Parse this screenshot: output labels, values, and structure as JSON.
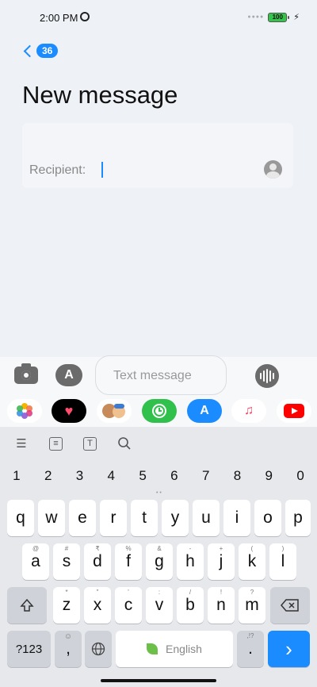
{
  "status_bar": {
    "time": "2:00 PM",
    "battery": "100"
  },
  "header": {
    "back_count": "36",
    "title": "New message"
  },
  "recipient": {
    "label": "Recipient:"
  },
  "compose": {
    "placeholder": "Text message"
  },
  "apps_row": {
    "items": [
      {
        "name": "photos-app",
        "color": "#ffffff"
      },
      {
        "name": "digital-touch-app",
        "color": "#000000"
      },
      {
        "name": "memoji-app",
        "color": "#ffffff"
      },
      {
        "name": "activity-app",
        "color": "#2fc14b"
      },
      {
        "name": "app-store-app",
        "color": "#1a8cff"
      },
      {
        "name": "music-app",
        "color": "#ffffff"
      },
      {
        "name": "youtube-app",
        "color": "#ffffff"
      }
    ]
  },
  "keyboard": {
    "numbers": [
      "1",
      "2",
      "3",
      "4",
      "5",
      "6",
      "7",
      "8",
      "9",
      "0"
    ],
    "row1": [
      "q",
      "w",
      "e",
      "r",
      "t",
      "y",
      "u",
      "i",
      "o",
      "p"
    ],
    "row2": [
      "a",
      "s",
      "d",
      "f",
      "g",
      "h",
      "j",
      "k",
      "l"
    ],
    "row2_alt": [
      "@",
      "#",
      "₹",
      "%",
      "&",
      "-",
      "+",
      "(",
      ")"
    ],
    "row3": [
      "z",
      "x",
      "c",
      "v",
      "b",
      "n",
      "m"
    ],
    "row3_alt": [
      "*",
      "\"",
      "'",
      ":",
      "/",
      "!",
      "?"
    ],
    "mode_key": "?123",
    "comma_key": ",",
    "space_label": "English",
    "period_key": ".",
    "period_alt": ",!?",
    "go_key": "›"
  }
}
